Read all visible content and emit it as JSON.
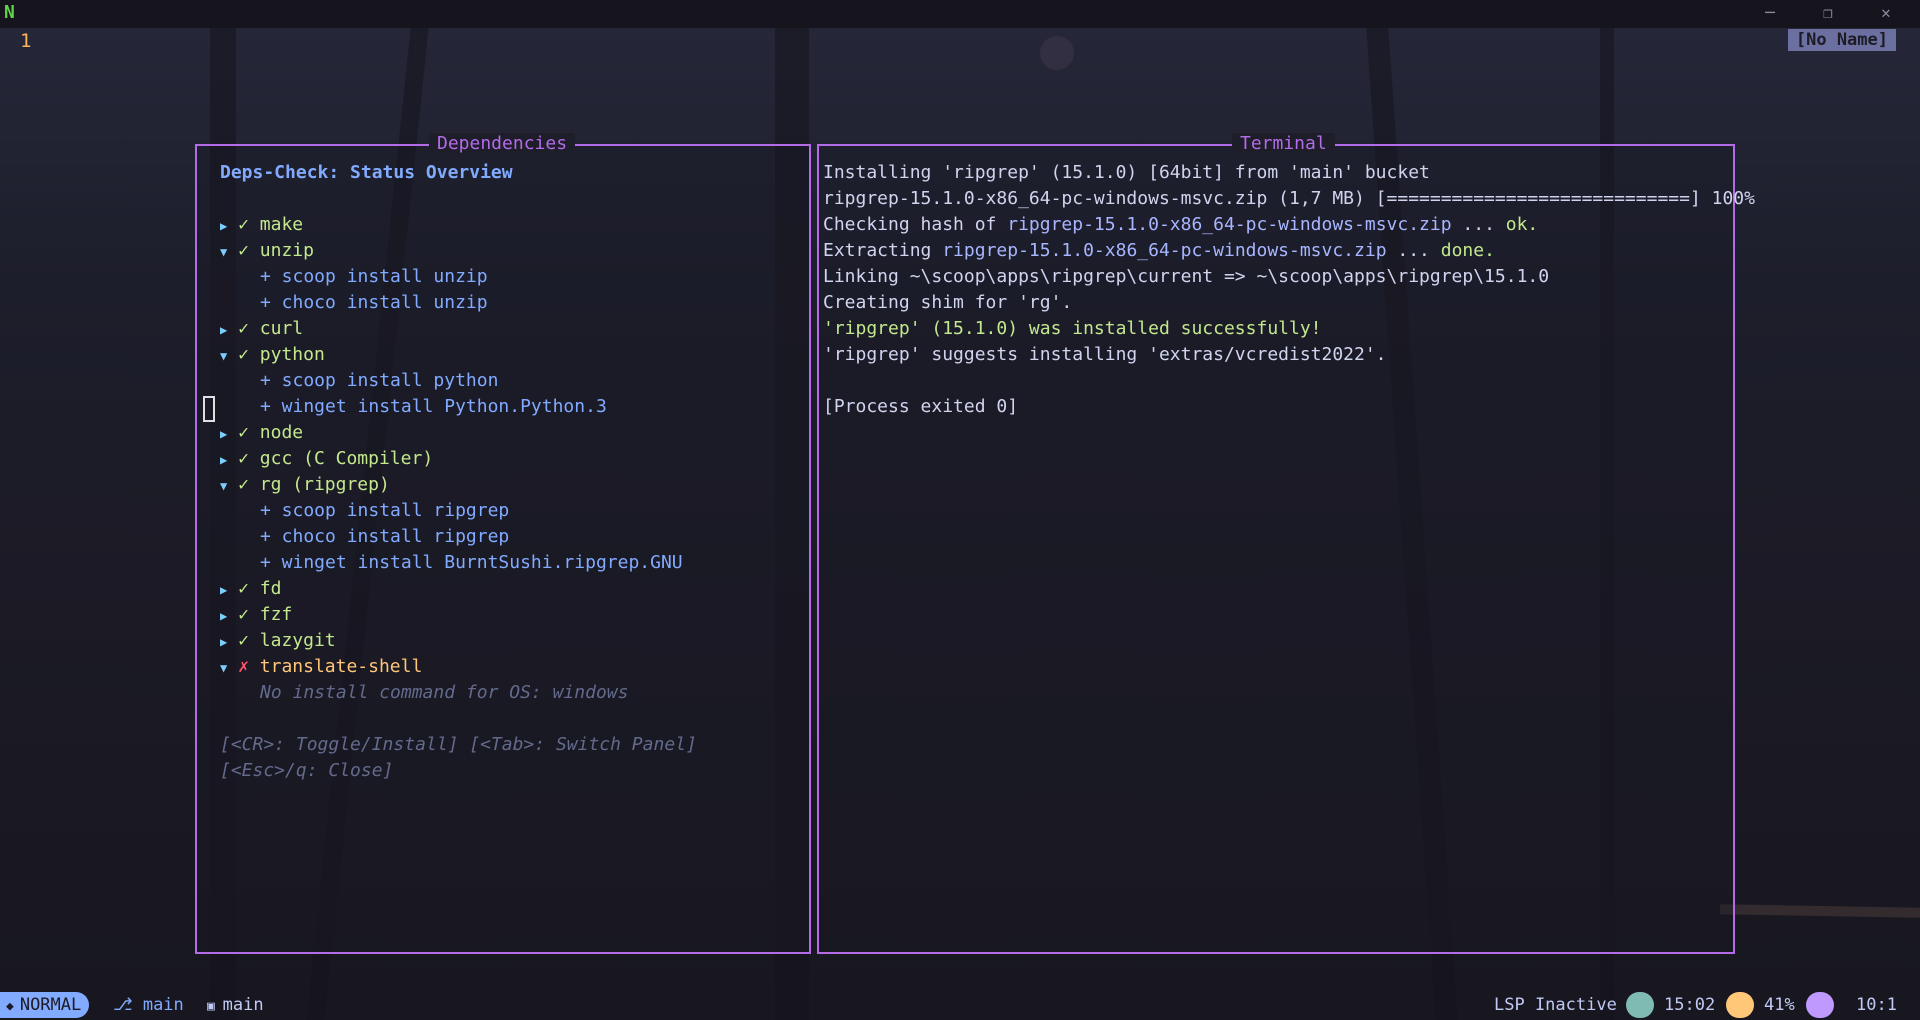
{
  "app": {
    "logo": "N"
  },
  "window_controls": [
    "─",
    "❐",
    "✕"
  ],
  "editor": {
    "line_number": "1",
    "buffer_name": "[No Name]"
  },
  "deps_panel": {
    "title": "Dependencies",
    "heading": "Deps-Check: Status Overview",
    "items": [
      {
        "arrow": "▶",
        "mark": "✓",
        "name": "make"
      },
      {
        "arrow": "▼",
        "mark": "✓",
        "name": "unzip"
      },
      {
        "sub": "+ scoop install unzip"
      },
      {
        "sub": "+ choco install unzip"
      },
      {
        "arrow": "▶",
        "mark": "✓",
        "name": "curl"
      },
      {
        "arrow": "▼",
        "mark": "✓",
        "name": "python"
      },
      {
        "sub": "+ scoop install python"
      },
      {
        "sub": "+ winget install Python.Python.3"
      },
      {
        "arrow": "▶",
        "mark": "✓",
        "name": "node"
      },
      {
        "arrow": "▶",
        "mark": "✓",
        "name": "gcc (C Compiler)"
      },
      {
        "arrow": "▼",
        "mark": "✓",
        "name": "rg (ripgrep)"
      },
      {
        "sub": "+ scoop install ripgrep"
      },
      {
        "sub": "+ choco install ripgrep"
      },
      {
        "sub": "+ winget install BurntSushi.ripgrep.GNU"
      },
      {
        "arrow": "▶",
        "mark": "✓",
        "name": "fd"
      },
      {
        "arrow": "▶",
        "mark": "✓",
        "name": "fzf"
      },
      {
        "arrow": "▶",
        "mark": "✓",
        "name": "lazygit"
      },
      {
        "arrow": "▼",
        "mark": "✗",
        "name": "translate-shell",
        "missing": true
      },
      {
        "note": "No install command for OS: windows"
      }
    ],
    "help_line1": "[<CR>: Toggle/Install] [<Tab>: Switch Panel]",
    "help_line2": "[<Esc>/q: Close]"
  },
  "terminal_panel": {
    "title": "Terminal",
    "lines": [
      {
        "segments": [
          {
            "text": "Installing 'ripgrep' (15.1.0) [64bit] from 'main' bucket",
            "style": "white"
          }
        ]
      },
      {
        "segments": [
          {
            "text": "ripgrep-15.1.0-x86_64-pc-windows-msvc.zip (1,7 MB) [============================] 100%",
            "style": "white"
          }
        ]
      },
      {
        "segments": [
          {
            "text": "Checking hash of ",
            "style": "white"
          },
          {
            "text": "ripgrep-15.1.0-x86_64-pc-windows-msvc.zip",
            "style": "path"
          },
          {
            "text": " ... ",
            "style": "white"
          },
          {
            "text": "ok.",
            "style": "green"
          }
        ]
      },
      {
        "segments": [
          {
            "text": "Extracting ",
            "style": "white"
          },
          {
            "text": "ripgrep-15.1.0-x86_64-pc-windows-msvc.zip",
            "style": "path"
          },
          {
            "text": " ... ",
            "style": "white"
          },
          {
            "text": "done.",
            "style": "green"
          }
        ]
      },
      {
        "segments": [
          {
            "text": "Linking ~\\scoop\\apps\\ripgrep\\current => ~\\scoop\\apps\\ripgrep\\15.1.0",
            "style": "white"
          }
        ]
      },
      {
        "segments": [
          {
            "text": "Creating shim for 'rg'.",
            "style": "white"
          }
        ]
      },
      {
        "segments": [
          {
            "text": "'ripgrep' (15.1.0) was installed successfully!",
            "style": "green"
          }
        ]
      },
      {
        "segments": [
          {
            "text": "'ripgrep' suggests installing 'extras/vcredist2022'.",
            "style": "white"
          }
        ]
      },
      {
        "segments": [
          {
            "text": "",
            "style": "white"
          }
        ]
      },
      {
        "segments": [
          {
            "text": "[Process exited 0]",
            "style": "white"
          }
        ]
      }
    ]
  },
  "statusbar": {
    "mode": "NORMAL",
    "branch": "main",
    "folder": "main",
    "lsp": "LSP Inactive",
    "time": "15:02",
    "battery": "41%",
    "position": "10:1"
  },
  "colors": {
    "accent": "#b36be8",
    "ok": "#c3e88d",
    "error": "#ff5370",
    "mode_bg": "#82aaff"
  },
  "icons": [
    "neovim-logo-icon",
    "minimize-icon",
    "maximize-icon",
    "close-icon",
    "mode-icon",
    "git-branch-icon",
    "folder-icon",
    "clock-icon",
    "battery-icon",
    "lsp-icon"
  ]
}
